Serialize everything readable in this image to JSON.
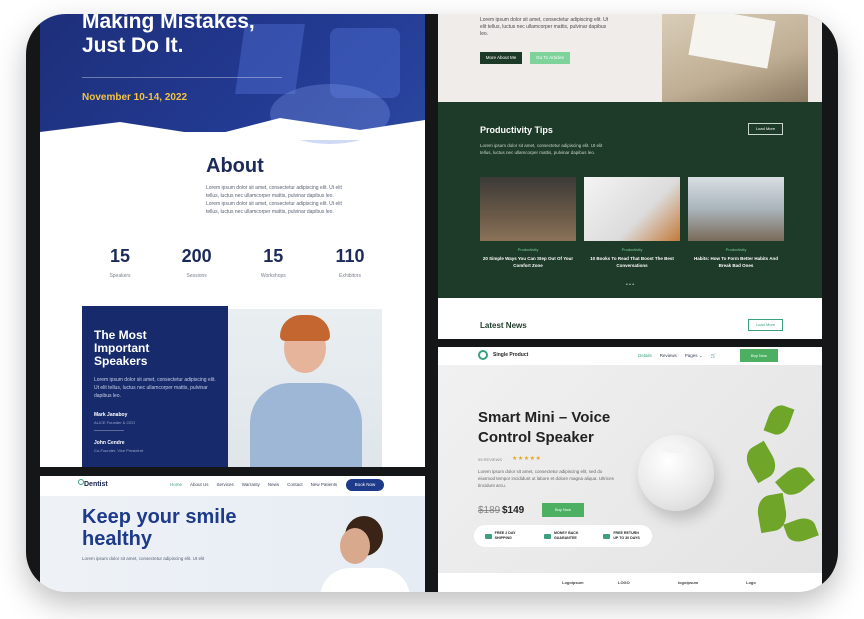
{
  "conference": {
    "hero_heading": "Making Mistakes, Just Do It.",
    "date": "November 10-14, 2022",
    "about_title": "About",
    "about_text": "Lorem ipsum dolor sit amet, consectetur adipiscing elit. Ut elit tellus, luctus nec ullamcorper mattis, pulvinar dapibus leo. Lorem ipsum dolor sit amet, consectetur adipiscing elit. Ut elit tellus, luctus nec ullamcorper mattis, pulvinar dapibus leo.",
    "stats": [
      {
        "value": "15",
        "label": "Speakers"
      },
      {
        "value": "200",
        "label": "Sessions"
      },
      {
        "value": "15",
        "label": "Workshops"
      },
      {
        "value": "110",
        "label": "Exhibitors"
      }
    ],
    "speakers_title": "The Most Important Speakers",
    "speakers_text": "Lorem ipsum dolor sit amet, consectetur adipiscing elit. Ut elit tellus, luctus nec ullamcorper mattis, pulvinar dapibus leo.",
    "speaker1_name": "Mark Janaboy",
    "speaker1_role": "ALICE Founder & CEO",
    "speaker2_name": "John Cendre",
    "speaker2_role": "Co-Founder, Vice President"
  },
  "dentist": {
    "logo": "Dentist",
    "menu": [
      "Home",
      "About Us",
      "Services",
      "Warranty",
      "News",
      "Contact",
      "New Patients"
    ],
    "book_button": "Book Now",
    "headline": "Keep your smile healthy",
    "sub": "Lorem ipsum dolor sit amet, consectetur adipiscing elit. Ut elit"
  },
  "productivity": {
    "top_text": "Lorem ipsum dolor sit amet, consectetur adipiscing elit. Ut elit tellus, luctus nec ullamcorper mattis, pulvinar dapibus leo.",
    "btn_more_about": "More About Me",
    "btn_articles": "Go To Articles",
    "tips_title": "Productivity Tips",
    "tips_text": "Lorem ipsum dolor sit amet, consectetur adipiscing elit. Ut elit tellus, luctus nec ullamcorper mattis, pulvinar dapibus leo.",
    "load_more": "Load More",
    "cards": [
      {
        "category": "Productivity",
        "title": "20 Simple Ways You Can Step Out Of Your Comfort Zone"
      },
      {
        "category": "Productivity",
        "title": "10 Books To Read That Boost The Best Conversations"
      },
      {
        "category": "Productivity",
        "title": "Habits: How To Form Better Habits And Break Bad Ones"
      }
    ],
    "latest_news": "Latest News",
    "load_more_2": "Load More"
  },
  "product": {
    "logo": "Single Product",
    "menu": [
      "Details",
      "Reviews",
      "Pages"
    ],
    "buy_now_nav": "Buy Now",
    "title": "Smart Mini – Voice Control Speaker",
    "reviews": "99 REVIEWS",
    "stars": "★★★★★",
    "description": "Lorem ipsum dolor sit amet, consectetur adipiscing elit, sed do eiusmod tempor incididunt ut labore et dolore magna aliqua. Ultrices tincidunt arcu.",
    "old_price": "$189",
    "new_price": "$149",
    "buy_now": "Buy Now",
    "features": [
      "FREE 2 DAY SHIPPING",
      "MONEY BACK GUARANTEE",
      "FREE RETURN UP TO 30 DAYS"
    ],
    "brand_logos": [
      "Logoipsum",
      "LOGO",
      "logoipsum",
      "Logo"
    ]
  },
  "colors": {
    "conference_blue": "#233a92",
    "accent_yellow": "#f3c442",
    "forest_green": "#1e3a29",
    "mint": "#7dd39a",
    "buy_green": "#4caf62"
  }
}
